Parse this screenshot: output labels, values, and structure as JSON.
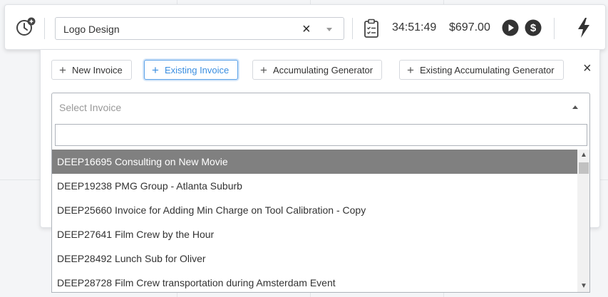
{
  "timer_bar": {
    "project_value": "Logo Design",
    "clear_symbol": "×",
    "elapsed": "34:51:49",
    "amount": "$697.00"
  },
  "icons": {
    "clock": "clock-plus-icon",
    "clipboard": "clipboard-checklist-icon",
    "play": "play-icon",
    "dollar": "dollar-icon",
    "bolt": "lightning-bolt-icon"
  },
  "tabs": [
    {
      "label": "New Invoice",
      "active": false
    },
    {
      "label": "Existing Invoice",
      "active": true
    },
    {
      "label": "Accumulating Generator",
      "active": false
    },
    {
      "label": "Existing Accumulating Generator",
      "active": false
    }
  ],
  "plus_symbol": "+",
  "close_symbol": "×",
  "invoice_select": {
    "placeholder": "Select Invoice",
    "search_value": ""
  },
  "invoices": [
    "DEEP16695 Consulting on New Movie",
    "DEEP19238 PMG Group - Atlanta Suburb",
    "DEEP25660 Invoice for Adding Min Charge on Tool Calibration - Copy",
    "DEEP27641 Film Crew by the Hour",
    "DEEP28492 Lunch Sub for Oliver",
    "DEEP28728 Film Crew transportation during Amsterdam Event"
  ],
  "highlighted_index": 0,
  "colors": {
    "accent": "#3a8ee0",
    "highlight": "#808080"
  }
}
